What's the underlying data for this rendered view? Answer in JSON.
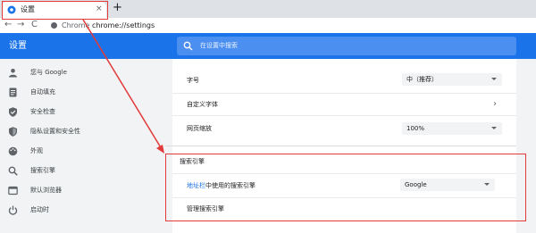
{
  "tab": {
    "title": "设置",
    "close": "×",
    "new_tab": "+"
  },
  "toolbar": {
    "back": "←",
    "forward": "→",
    "reload": "C",
    "omnibox_chip": "Chrome",
    "omnibox_sep": "|",
    "url": "chrome://settings"
  },
  "header": {
    "title": "设置",
    "search_placeholder": "在设置中搜索"
  },
  "sidebar": {
    "items": [
      {
        "label": "您与 Google",
        "icon": "person-icon"
      },
      {
        "label": "自动填充",
        "icon": "document-icon"
      },
      {
        "label": "安全检查",
        "icon": "shield-check-icon"
      },
      {
        "label": "隐私设置和安全性",
        "icon": "shield-icon"
      },
      {
        "label": "外观",
        "icon": "palette-icon"
      },
      {
        "label": "搜索引擎",
        "icon": "search-icon"
      },
      {
        "label": "默认浏览器",
        "icon": "browser-icon"
      },
      {
        "label": "启动时",
        "icon": "power-icon"
      }
    ]
  },
  "main": {
    "font_size": {
      "label": "字号",
      "value": "中（推荐）"
    },
    "custom_fonts": {
      "label": "自定义字体"
    },
    "page_zoom": {
      "label": "网页缩放",
      "value": "100%"
    },
    "search_engine": {
      "title": "搜索引擎",
      "address_bar_link": "地址栏",
      "address_bar_rest": "中使用的搜索引擎",
      "value": "Google",
      "manage_label": "管理搜索引擎"
    }
  },
  "colors": {
    "accent": "#1a73e8",
    "annotation": "#e23a3a",
    "sidebar_bg": "#f1f3f4"
  }
}
